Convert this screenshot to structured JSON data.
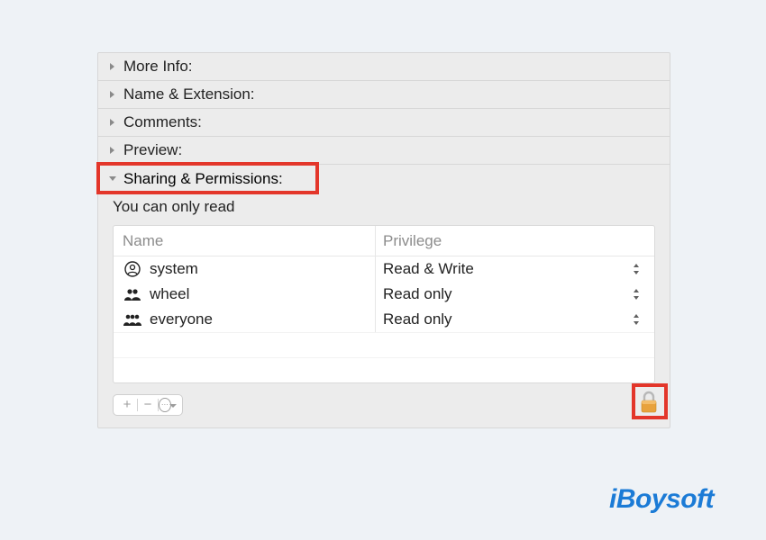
{
  "sections": {
    "more_info": "More Info:",
    "name_extension": "Name & Extension:",
    "comments": "Comments:",
    "preview": "Preview:",
    "sharing_permissions": "Sharing & Permissions:"
  },
  "sharing": {
    "status_text": "You can only read",
    "columns": {
      "name": "Name",
      "privilege": "Privilege"
    },
    "rows": [
      {
        "icon": "user",
        "name": "system",
        "privilege": "Read & Write"
      },
      {
        "icon": "group2",
        "name": "wheel",
        "privilege": "Read only"
      },
      {
        "icon": "group3",
        "name": "everyone",
        "privilege": "Read only"
      }
    ]
  },
  "toolbar": {
    "add": "+",
    "remove": "−",
    "action": "⋯"
  },
  "watermark": "iBoysoft",
  "colors": {
    "highlight": "#e3362a",
    "accent": "#1b7bd6",
    "lock_body": "#e8a23c"
  }
}
